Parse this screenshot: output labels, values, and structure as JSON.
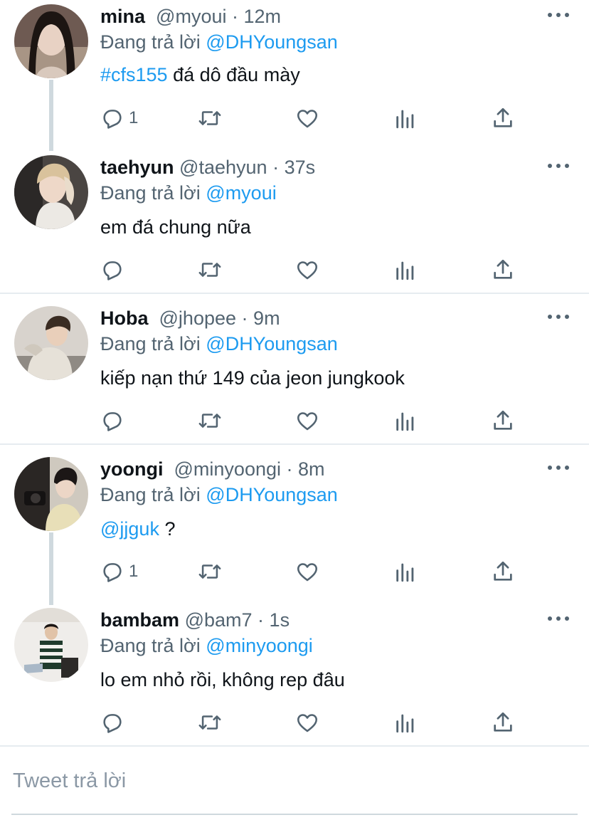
{
  "tweets": [
    {
      "name": "mina",
      "handle": "@myoui",
      "dot": "·",
      "time": "12m",
      "reply_prefix": "Đang trả lời",
      "reply_to": "@DHYoungsan",
      "text_link": "#cfs155",
      "text": " đá dô đầu mày",
      "reply_count": "1"
    },
    {
      "name": "taehyun",
      "handle": "@taehyun",
      "dot": "·",
      "time": "37s",
      "reply_prefix": "Đang trả lời",
      "reply_to": "@myoui",
      "text_link": "",
      "text": "em đá chung nữa",
      "reply_count": ""
    },
    {
      "name": "Hoba",
      "handle": "@jhopee",
      "dot": "·",
      "time": "9m",
      "reply_prefix": "Đang trả lời",
      "reply_to": "@DHYoungsan",
      "text_link": "",
      "text": "kiếp nạn thứ 149 của jeon jungkook",
      "reply_count": ""
    },
    {
      "name": "yoongi",
      "handle": "@minyoongi",
      "dot": "·",
      "time": "8m",
      "reply_prefix": "Đang trả lời",
      "reply_to": "@DHYoungsan",
      "text_link": "@jjguk",
      "text": " ?",
      "reply_count": "1"
    },
    {
      "name": "bambam",
      "handle": "@bam7",
      "dot": "·",
      "time": "1s",
      "reply_prefix": "Đang trả lời",
      "reply_to": "@minyoongi",
      "text_link": "",
      "text": "lo em nhỏ rồi, không rep đâu",
      "reply_count": ""
    }
  ],
  "compose": {
    "placeholder": "Tweet trả lời"
  },
  "colors": {
    "link": "#1d9bf0",
    "muted": "#536471",
    "text": "#0f1419",
    "divider": "#e6ecf0"
  },
  "icons": [
    "reply-icon",
    "retweet-icon",
    "like-icon",
    "analytics-icon",
    "share-icon",
    "more-icon"
  ]
}
